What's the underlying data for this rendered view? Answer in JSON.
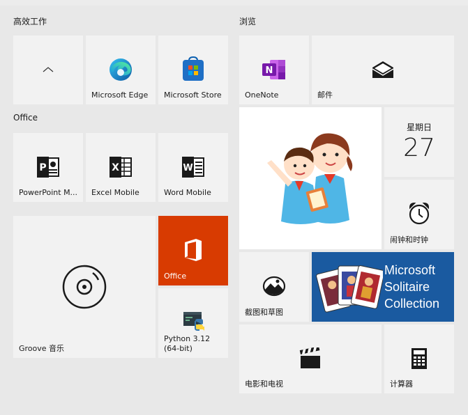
{
  "groups": {
    "productivity": "高效工作",
    "browse": "浏览",
    "office": "Office"
  },
  "tiles": {
    "edge": "Microsoft Edge",
    "store": "Microsoft Store",
    "onenote": "OneNote",
    "mail": "邮件",
    "powerpoint": "PowerPoint M...",
    "excel": "Excel Mobile",
    "word": "Word Mobile",
    "groove": "Groove 音乐",
    "office": "Office",
    "python_line1": "Python 3.12",
    "python_line2": "(64-bit)",
    "calendar_day": "星期日",
    "calendar_date": "27",
    "alarms": "闹钟和时钟",
    "snip": "截图和草图",
    "solitaire_line1": "Microsoft",
    "solitaire_line2": "Solitaire",
    "solitaire_line3": "Collection",
    "movies": "电影和电视",
    "calculator": "计算器"
  },
  "colors": {
    "tile_bg": "#f2f2f2",
    "office_orange": "#d83b01",
    "solitaire_blue": "#1a5aa0",
    "onenote_purple": "#7719aa"
  }
}
